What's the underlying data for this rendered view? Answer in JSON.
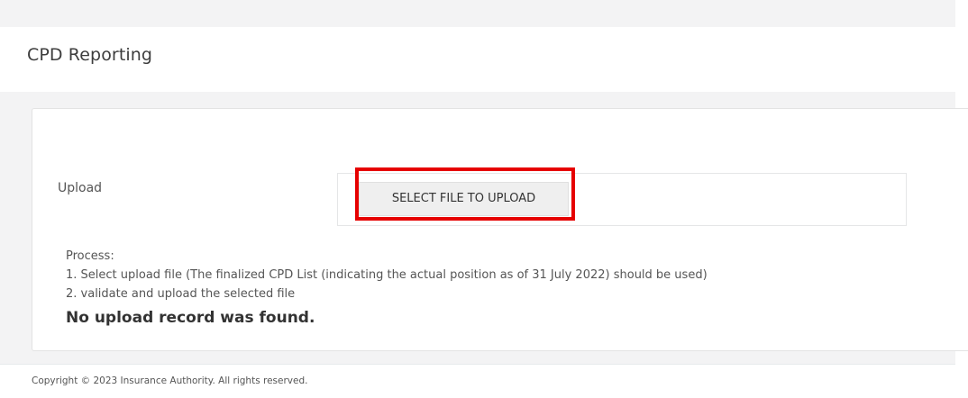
{
  "header": {
    "title": "CPD Reporting"
  },
  "upload": {
    "label": "Upload",
    "button_label": "SELECT FILE TO UPLOAD",
    "highlight_color": "#e60000"
  },
  "process": {
    "heading": "Process:",
    "steps": [
      "1. Select upload file (The finalized CPD List (indicating the actual position as of 31 July 2022) should be used)",
      "2. validate and upload the selected file"
    ]
  },
  "status": {
    "message": "No upload record was found."
  },
  "footer": {
    "copyright": "Copyright © 2023 Insurance Authority. All rights reserved."
  }
}
